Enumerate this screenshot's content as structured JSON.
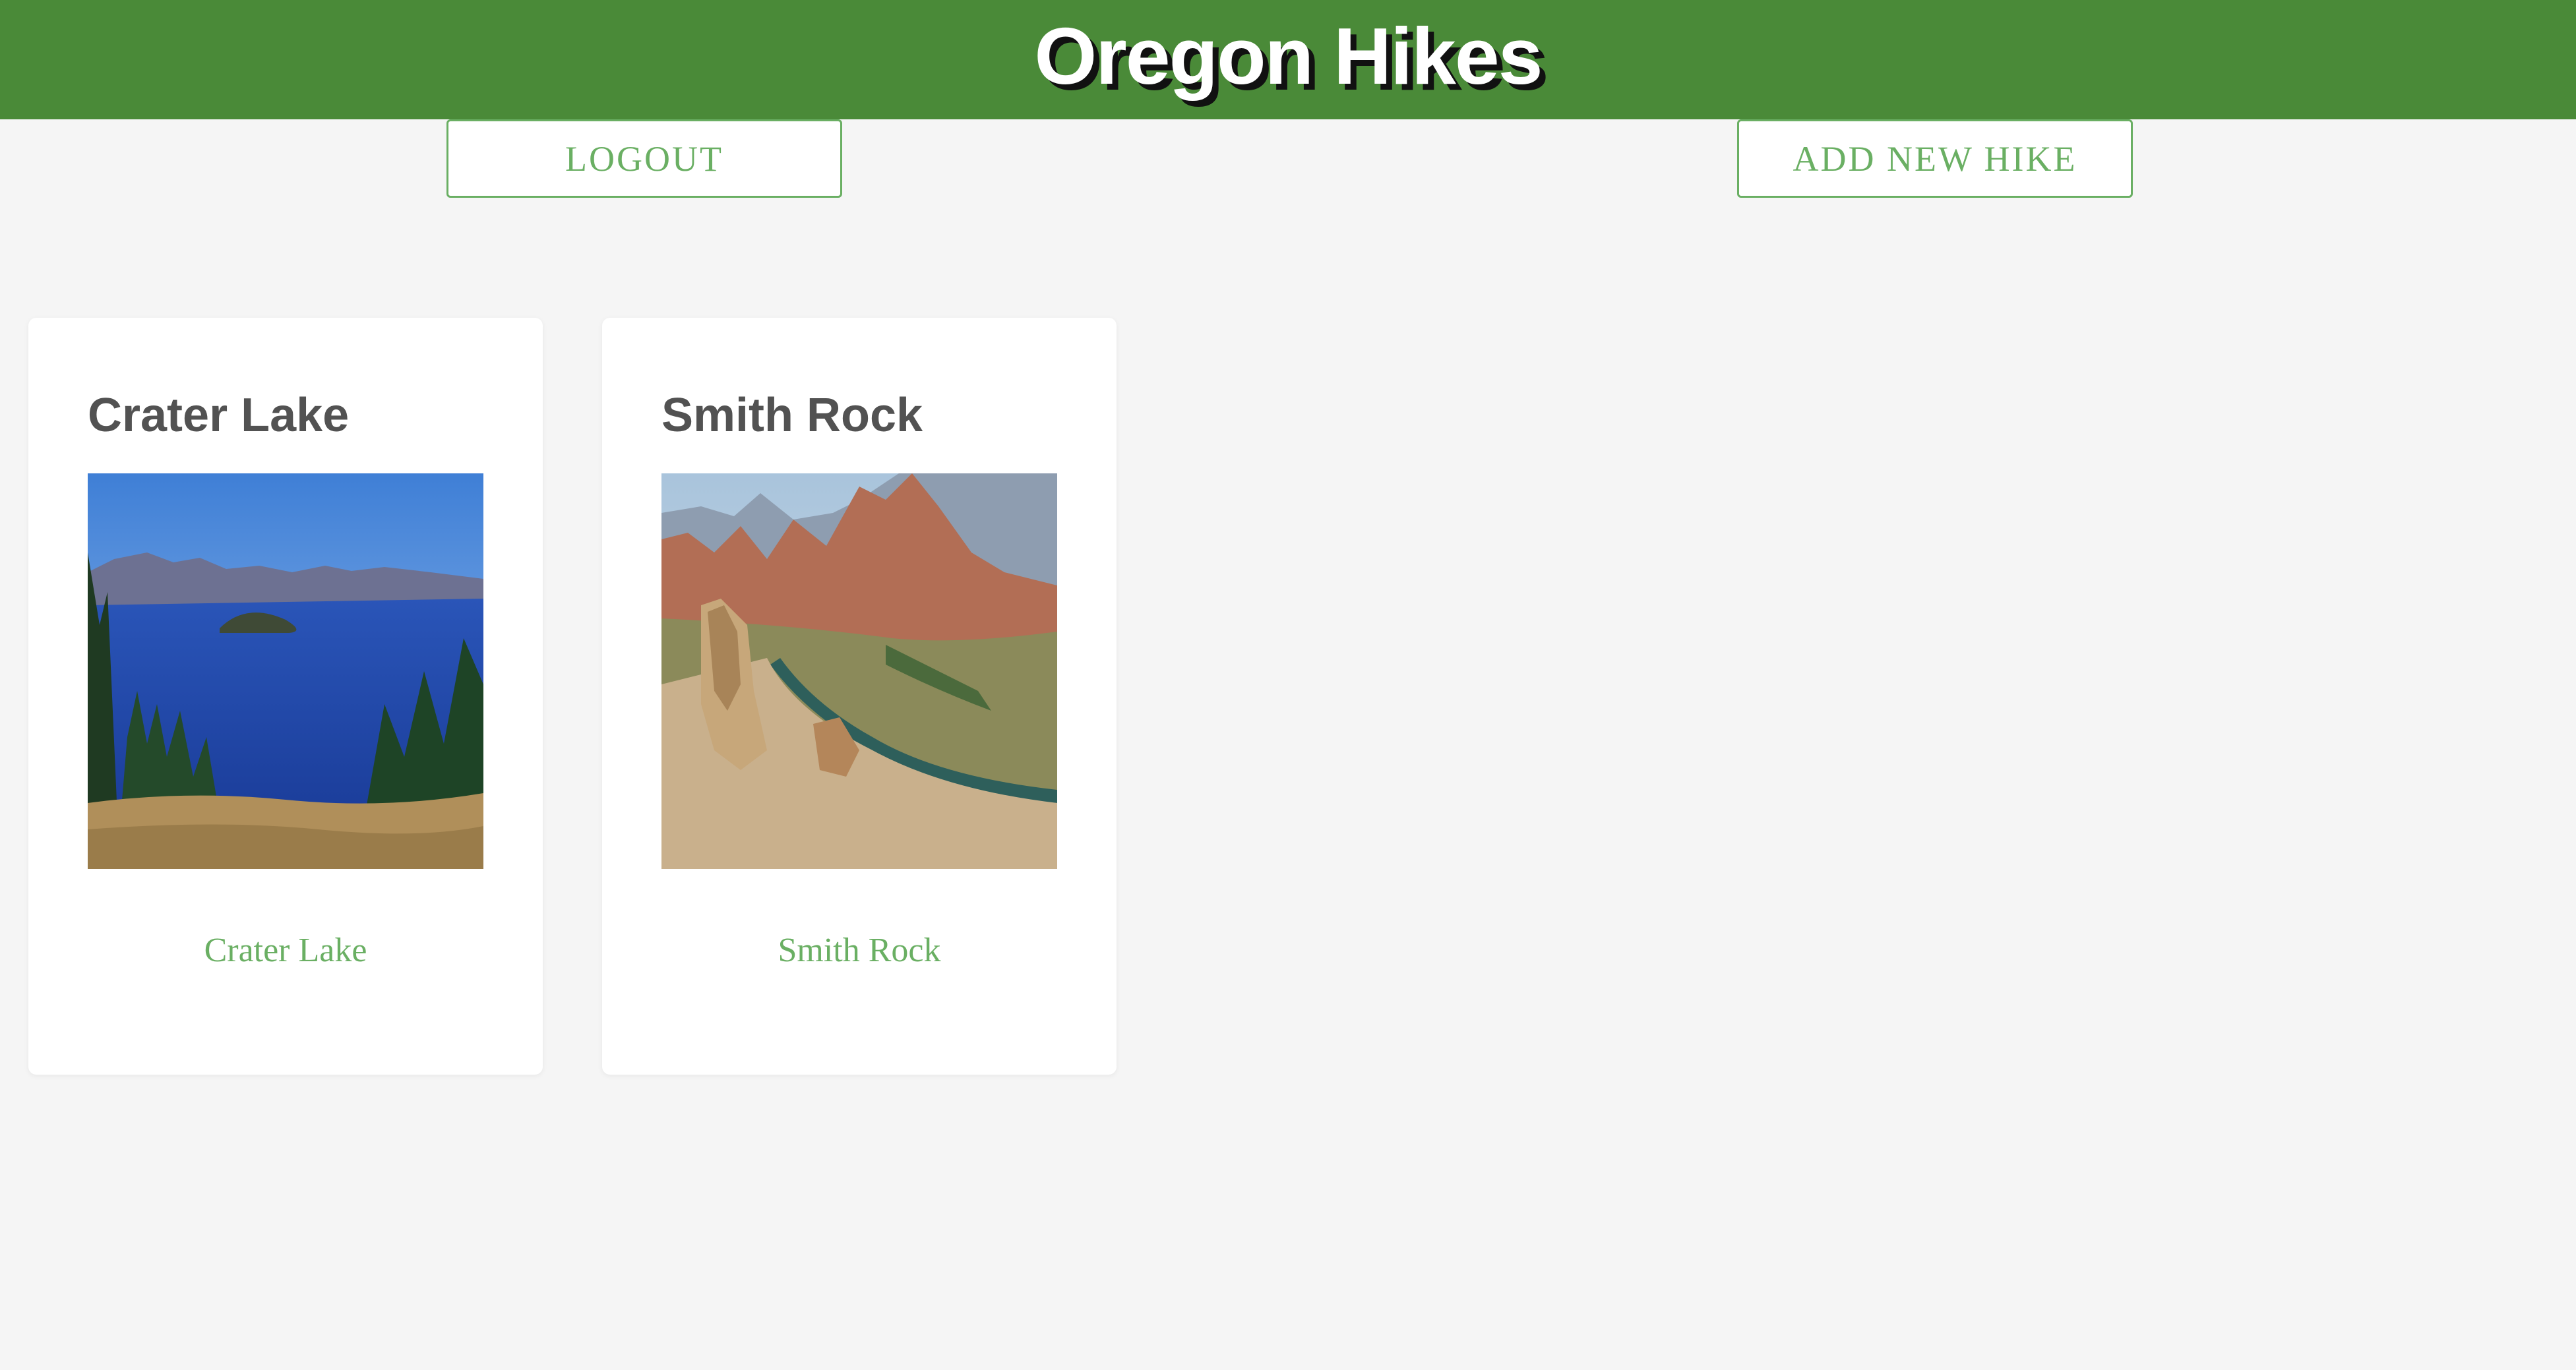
{
  "header": {
    "title": "Oregon Hikes"
  },
  "actions": {
    "logout_label": "LOGOUT",
    "add_label": "ADD NEW HIKE"
  },
  "hikes": [
    {
      "title": "Crater Lake",
      "link_label": "Crater Lake",
      "image_subject": "crater-lake-photo"
    },
    {
      "title": "Smith Rock",
      "link_label": "Smith Rock",
      "image_subject": "smith-rock-photo"
    }
  ],
  "colors": {
    "header_bg": "#4a8a38",
    "accent": "#6aaf63",
    "page_bg": "#f5f5f5",
    "card_title": "#525252"
  }
}
